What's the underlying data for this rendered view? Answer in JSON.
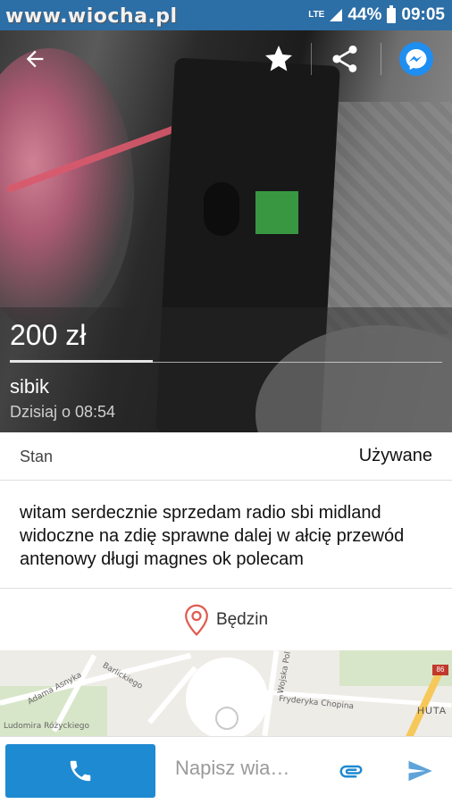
{
  "status_bar": {
    "watermark": "www.wiocha.pl",
    "network": "LTE",
    "battery": "44%",
    "time": "09:05"
  },
  "header": {
    "back_icon": "arrow-left-icon",
    "favorite_icon": "star-icon",
    "share_icon": "share-icon",
    "messenger_icon": "messenger-icon"
  },
  "listing": {
    "price": "200 zł",
    "seller": "sibik",
    "date": "Dzisiaj o 08:54",
    "condition_label": "Stan",
    "condition_value": "Używane",
    "description": "witam serdecznie sprzedam radio sbi midland widoczne na zdię sprawne dalej w ałcię przewód antenowy długi magnes ok polecam",
    "location": "Będzin"
  },
  "map": {
    "labels": [
      "Adama Asnyka",
      "Barlickiego",
      "Wojska Pol",
      "Fryderyka Chopina",
      "Ludomira Różyckiego",
      "HUTA",
      "86"
    ]
  },
  "bottom_bar": {
    "message_placeholder": "Napisz wia…"
  },
  "colors": {
    "status_bar": "#2c6ea6",
    "call_button": "#1e8ad1",
    "accent_blue": "#1e8ad1",
    "location_pin": "#e05b4f"
  }
}
